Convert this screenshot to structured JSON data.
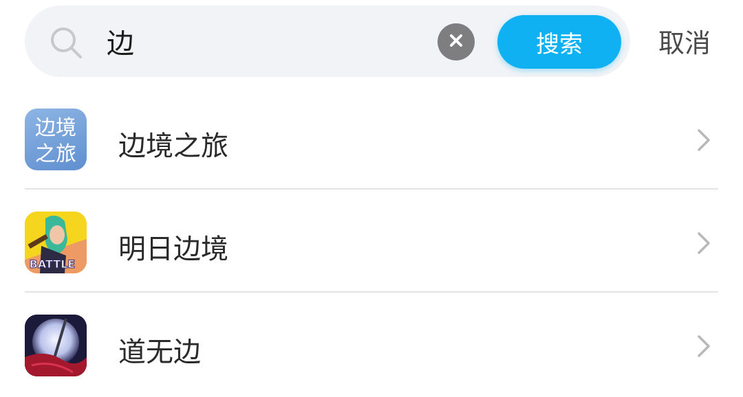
{
  "search": {
    "value": "边",
    "search_button_label": "搜索",
    "cancel_label": "取消",
    "icon": "search-icon",
    "clear_icon": "close-icon"
  },
  "results": [
    {
      "name": "边境之旅",
      "icon": "app-icon-bianjing-zhilv",
      "icon_text_line1": "边境",
      "icon_text_line2": "之旅"
    },
    {
      "name": "明日边境",
      "icon": "app-icon-mingri-bianjing",
      "icon_text": "BATTLE"
    },
    {
      "name": "道无边",
      "icon": "app-icon-dao-wu-bian"
    }
  ],
  "colors": {
    "accent": "#0fb1f3",
    "search_bg": "#f1f3f6",
    "clear_bg": "#7e7e80",
    "divider": "#e3e3e3"
  }
}
